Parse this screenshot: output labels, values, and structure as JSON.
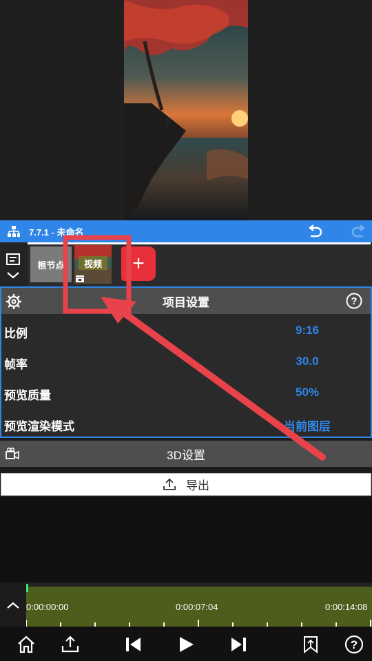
{
  "titlebar": {
    "title": "7.7.1 - 未命名"
  },
  "layers": {
    "root_label": "根节点",
    "video_label": "视频",
    "add_label": "+"
  },
  "panel": {
    "title": "项目设置",
    "rows": [
      {
        "label": "比例",
        "value": "9:16"
      },
      {
        "label": "帧率",
        "value": "30.0"
      },
      {
        "label": "预览质量",
        "value": "50%"
      },
      {
        "label": "预览渲染模式",
        "value": "当前图层"
      }
    ]
  },
  "settings3d": {
    "label": "3D设置"
  },
  "export": {
    "label": "导出"
  },
  "timeline": {
    "tc0": "0:00:00:00",
    "tc1": "0:00:07:04",
    "tc2": "0:00:14:08"
  },
  "colors": {
    "accent": "#2f86e8",
    "add": "#e8303a",
    "annotation": "#e8434a",
    "track": "#4d5d1c"
  },
  "icons": [
    "tree-icon",
    "undo-icon",
    "redo-icon",
    "menu-icon",
    "chevron-down-icon",
    "gear-icon",
    "help-icon",
    "camera-icon",
    "upload-icon",
    "chevron-up-icon",
    "home-icon",
    "share-icon",
    "skip-back-icon",
    "play-icon",
    "skip-forward-icon",
    "bookmark-icon"
  ]
}
